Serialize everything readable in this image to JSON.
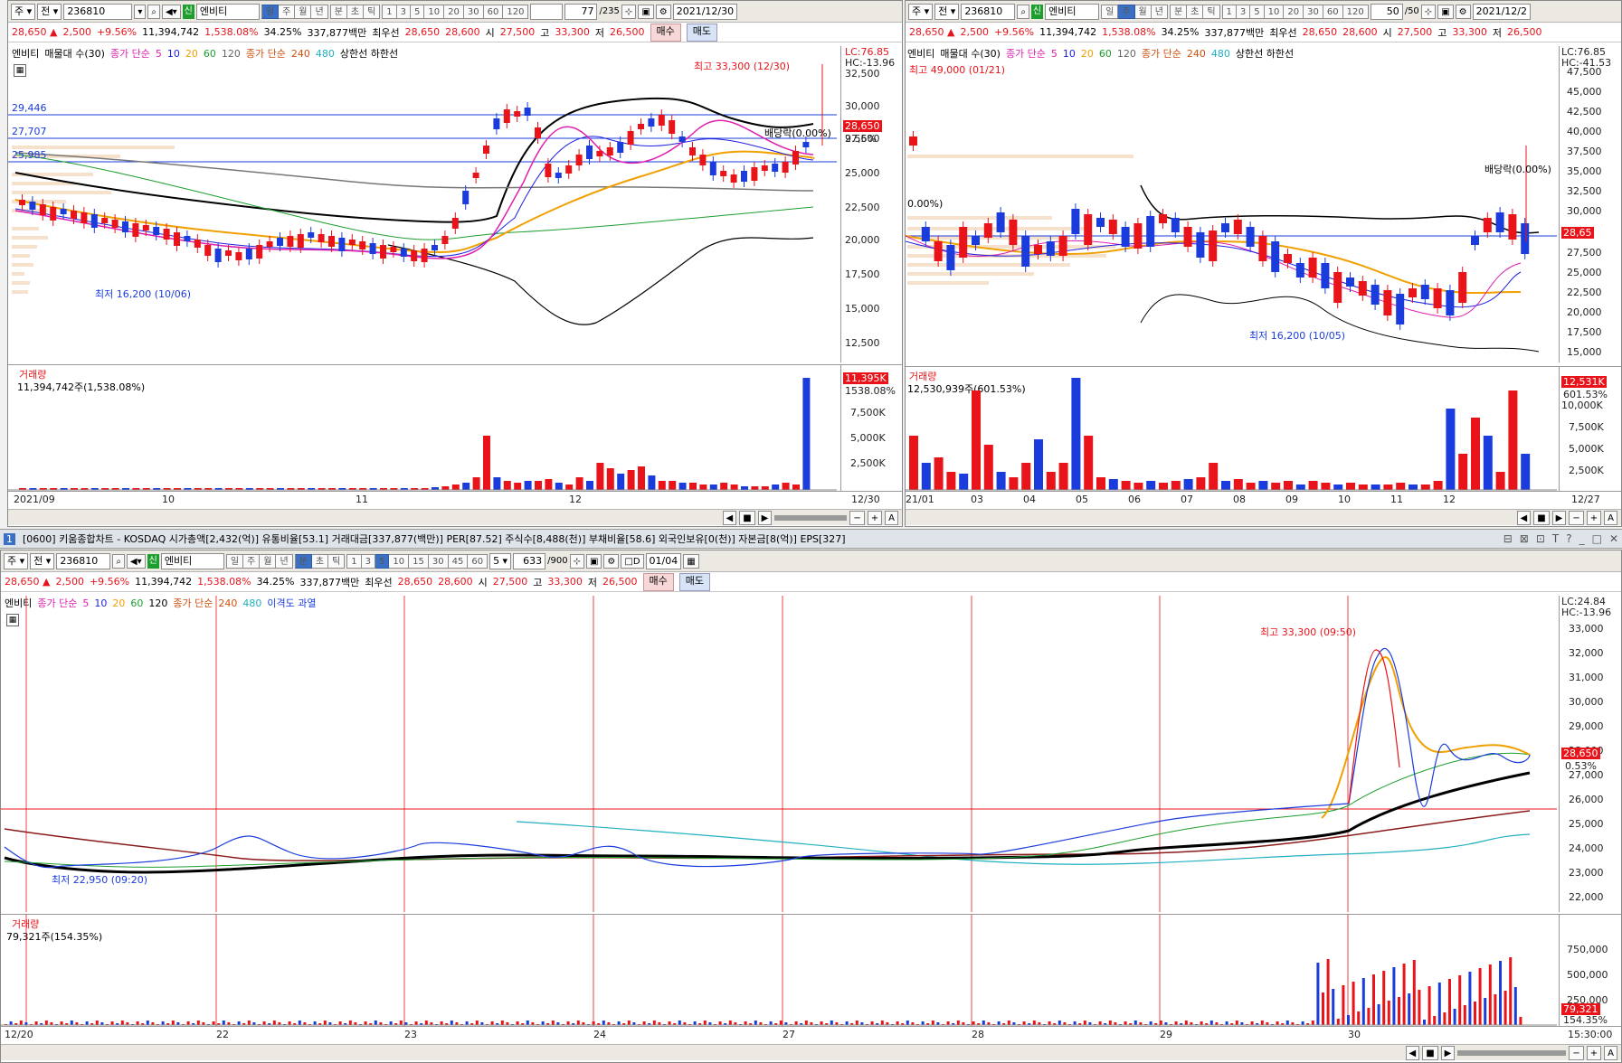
{
  "common": {
    "market_menu": "주",
    "market_submenu": "전",
    "code": "236810",
    "credit_tag": "신",
    "name": "엔비티",
    "quote": {
      "price": "28,650",
      "change": "2,500",
      "change_rate": "+9.56%",
      "volume": "11,394,742",
      "volume_rate": "1,538.08%",
      "turnover": "34.25%",
      "amount": "337,877백만",
      "best_label": "최우선",
      "best_ask": "28,650",
      "best_bid": "28,600",
      "open_label": "시",
      "open": "27,500",
      "high_label": "고",
      "high": "33,300",
      "low_label": "저",
      "low": "26,500"
    },
    "buy_button": "매수",
    "sell_button": "매도",
    "volume_title": "거래량",
    "arrow_up_symbol": "▲",
    "colors": {
      "up": "#e8141a",
      "down": "#1a3cdc",
      "ma5": "#e020b0",
      "ma10": "#2020e0",
      "ma20": "#f0a000",
      "ma60": "#1e9e2e",
      "ma240": "#d05010",
      "ma480": "#20b0c0"
    }
  },
  "left_chart": {
    "period_tabs": [
      "일",
      "주",
      "월",
      "년",
      "분",
      "초",
      "틱"
    ],
    "active_period": "일",
    "number_tabs": [
      "1",
      "3",
      "5",
      "10",
      "20",
      "30",
      "60",
      "120"
    ],
    "count": "77",
    "count_total": "/235",
    "date": "2021/12/30",
    "legend": {
      "name": "엔비티",
      "vp": "매물대 수(30)",
      "ma_label": "종가 단순",
      "ma_periods": [
        "5",
        "10",
        "20",
        "60",
        "120"
      ],
      "ma_long_label": "종가 단순",
      "ma_long_periods": [
        "240",
        "480"
      ],
      "bands": "상한선 하한선"
    },
    "lc": "LC:76.85",
    "hc": "HC:-13.96",
    "high_label": "최고 33,300 (12/30)",
    "low_label": "최저 16,200 (10/06)",
    "dividend_label": "배당락(0.00%)",
    "levels": [
      "29,446",
      "27,707",
      "25,985"
    ],
    "price_badge": "28,650",
    "rate_badge": "9.56%",
    "y_ticks": [
      "32,500",
      "30,000",
      "27,500",
      "25,000",
      "22,500",
      "20,000",
      "17,500",
      "15,000",
      "12,500"
    ],
    "volume_value": "11,394,742주(1,538.08%)",
    "volume_badge": "11,395K",
    "volume_badge_rate": "1538.08%",
    "vol_ticks": [
      "7,500K",
      "5,000K",
      "2,500K"
    ],
    "x_labels": [
      "2021/09",
      "10",
      "11",
      "12"
    ],
    "x_last": "12/30"
  },
  "right_chart": {
    "period_tabs": [
      "일",
      "주",
      "월",
      "년",
      "분",
      "초",
      "틱"
    ],
    "active_period": "주",
    "number_tabs": [
      "1",
      "3",
      "5",
      "10",
      "20",
      "30",
      "60",
      "120"
    ],
    "count": "50",
    "count_total": "/50",
    "date": "2021/12/2",
    "lc": "LC:76.85",
    "hc": "HC:-41.53",
    "high_label": "최고 49,000 (01/21)",
    "low_label": "최저 16,200 (10/05)",
    "dividend_label": "배당락(0.00%)",
    "partial_label": "0.00%)",
    "price_badge": "28,65",
    "y_ticks": [
      "47,500",
      "45,000",
      "42,500",
      "40,000",
      "37,500",
      "35,000",
      "32,500",
      "30,000",
      "27,500",
      "25,000",
      "22,500",
      "20,000",
      "17,500",
      "15,000"
    ],
    "volume_value": "12,530,939주(601.53%)",
    "volume_badge": "12,531K",
    "volume_badge_rate": "601.53%",
    "vol_ticks": [
      "10,000K",
      "7,500K",
      "5,000K",
      "2,500K"
    ],
    "x_labels": [
      "21/01",
      "03",
      "04",
      "05",
      "06",
      "07",
      "08",
      "09",
      "10",
      "11",
      "12"
    ],
    "x_last": "12/27"
  },
  "bottom_chart": {
    "title_bar": "[0600] 키움종합차트 - KOSDAQ 시가총액[2,432(억)] 유통비율[53.1] 거래대금[337,877(백만)] PER[87.52] 주식수[8,488(천)] 부채비율[58.6] 외국인보유[0(천)] 자본금[8(억)] EPS[327]",
    "window_number": "1",
    "period_tabs": [
      "일",
      "주",
      "월",
      "년",
      "분",
      "초",
      "틱"
    ],
    "active_period": "분",
    "number_tabs": [
      "1",
      "3",
      "5",
      "10",
      "15",
      "30",
      "45",
      "60"
    ],
    "active_number": "5",
    "interval_select": "5",
    "count": "633",
    "count_total": "/900",
    "date": "01/04",
    "legend": {
      "name": "엔비티",
      "ma_label": "종가 단순",
      "ma_periods": [
        "5",
        "10",
        "20",
        "60",
        "120"
      ],
      "ma_long_label": "종가 단순",
      "ma_long_periods": [
        "240",
        "480"
      ],
      "extra": "이격도 과열"
    },
    "lc": "LC:24.84",
    "hc": "HC:-13.96",
    "high_label": "최고 33,300 (09:50)",
    "low_label": "최저 22,950 (09:20)",
    "price_badge": "28,650",
    "rate_badge": "0.53%",
    "y_ticks": [
      "33,000",
      "32,000",
      "31,000",
      "30,000",
      "29,000",
      "28,000",
      "27,000",
      "26,000",
      "25,000",
      "24,000",
      "23,000",
      "22,000"
    ],
    "volume_value": "79,321주(154.35%)",
    "volume_badge": "79,321",
    "volume_badge_rate": "154.35%",
    "vol_ticks": [
      "750,000",
      "500,000",
      "250,000"
    ],
    "x_labels": [
      "12/20",
      "22",
      "23",
      "24",
      "27",
      "28",
      "29",
      "30"
    ],
    "x_last": "15:30:00"
  }
}
